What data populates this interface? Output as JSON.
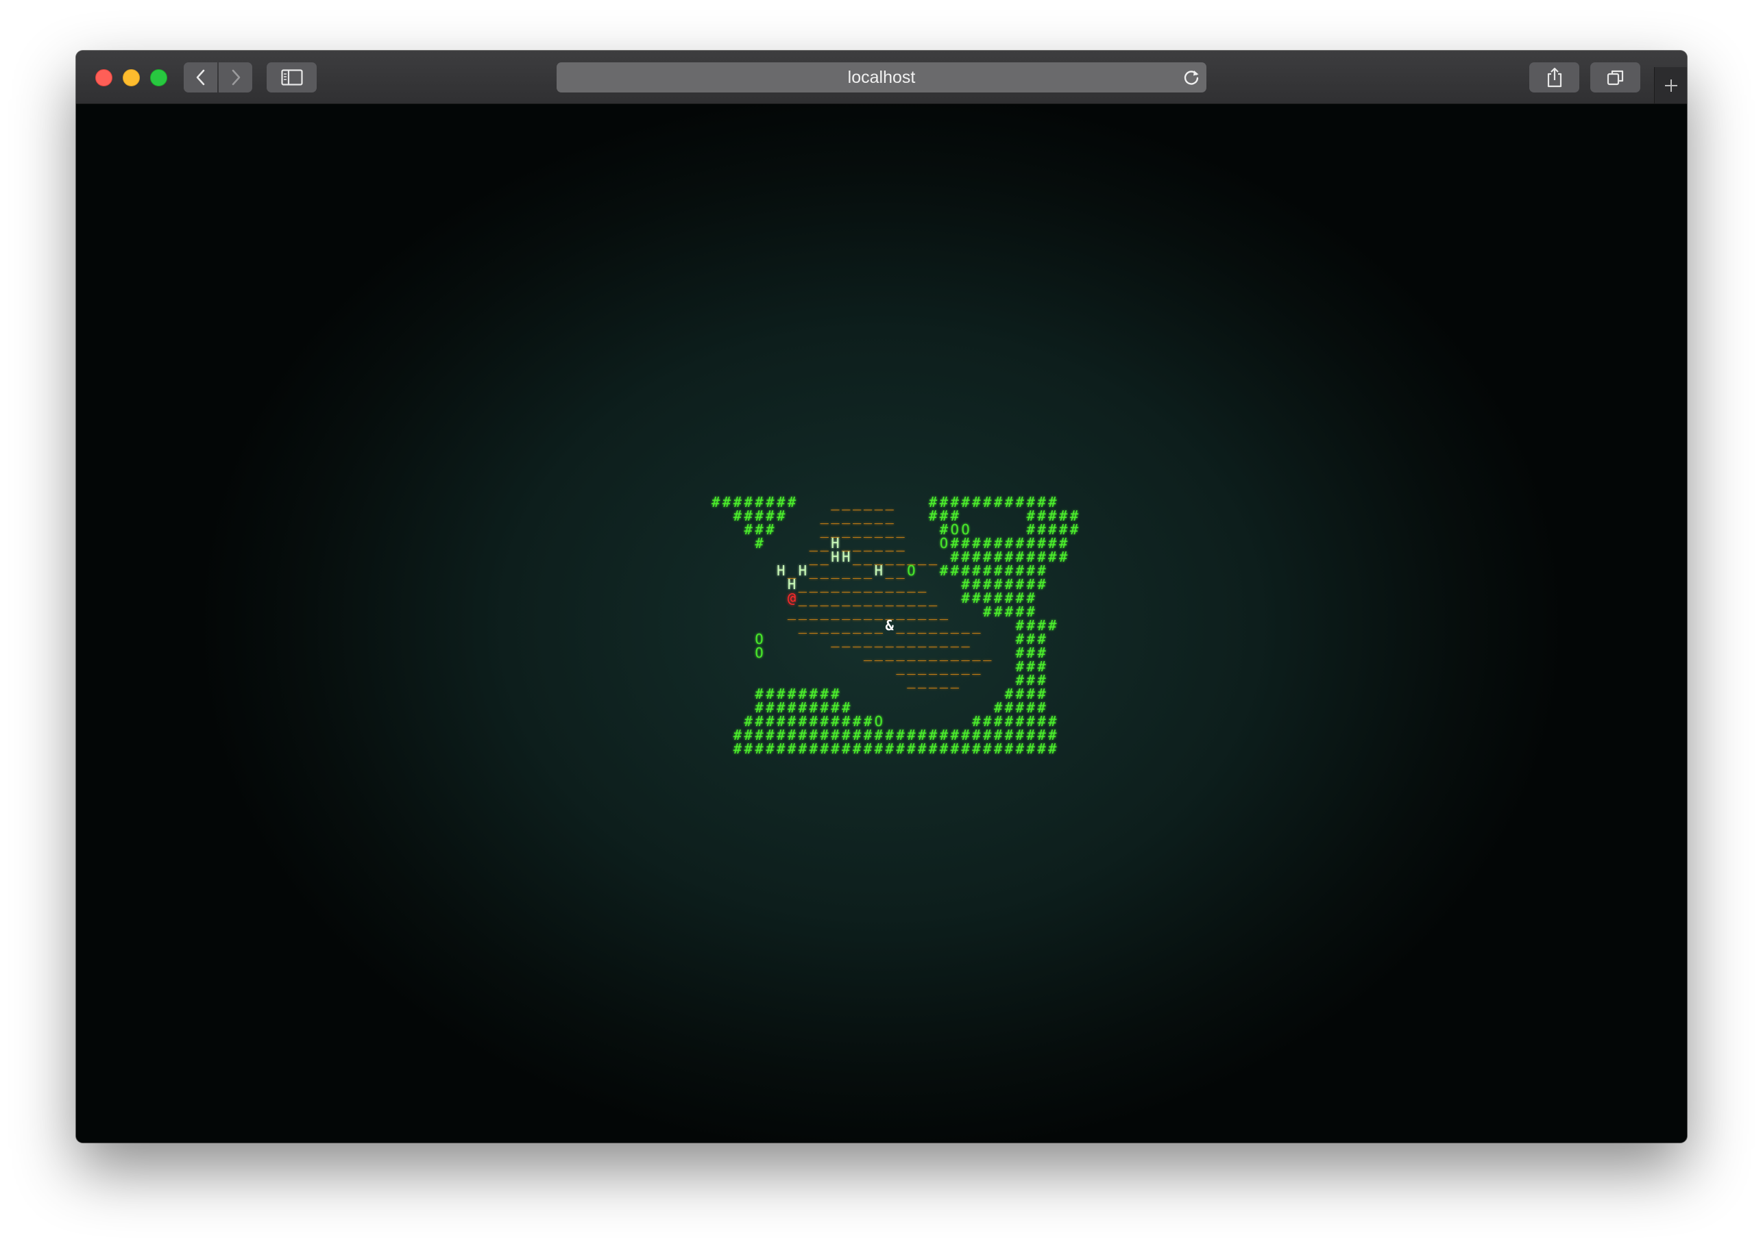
{
  "browser": {
    "url": "localhost",
    "icons": {
      "close": "close-dot",
      "minimize": "minimize-dot",
      "zoom": "zoom-dot",
      "back": "chevron-left-icon",
      "forward": "chevron-right-icon",
      "sidebar": "sidebar-icon",
      "reload": "reload-icon",
      "share": "share-icon",
      "tabs": "tabs-overview-icon",
      "new_tab": "plus-icon"
    },
    "traffic_colors": [
      "#fe5f57",
      "#febc2e",
      "#28c840"
    ]
  },
  "game": {
    "colors": {
      "wall": "#4cf02c",
      "floor": "#e08a12",
      "ladder": "#c9f9b8",
      "boulder": "#48e82a",
      "player": "#ff2a2a",
      "item": "#ffffff",
      "default": "#4cf02c"
    },
    "legend": {
      "#": "wall",
      "_": "floor",
      "H": "ladder",
      "O": "boulder",
      "@": "player",
      "&": "item"
    },
    "map": [
      "########   ______   ############",
      "  #####   _______   ###      #####",
      "   ###    ________   #OO     #####",
      "    #    __H______   O###########",
      "         __HH________ ###########",
      "      H_H______H__O  ##########",
      "       H____________   ########",
      "       @_____________  #######",
      "       _______________   #####",
      "        ________&________   ####",
      "    O      _____________    ###",
      "    O         ____________  ###",
      "                 ________   ###",
      "                  _____     ###",
      "    ########               ####",
      "    #########             #####",
      "   ############O        ########",
      "  ##############################",
      "  ##############################"
    ]
  }
}
